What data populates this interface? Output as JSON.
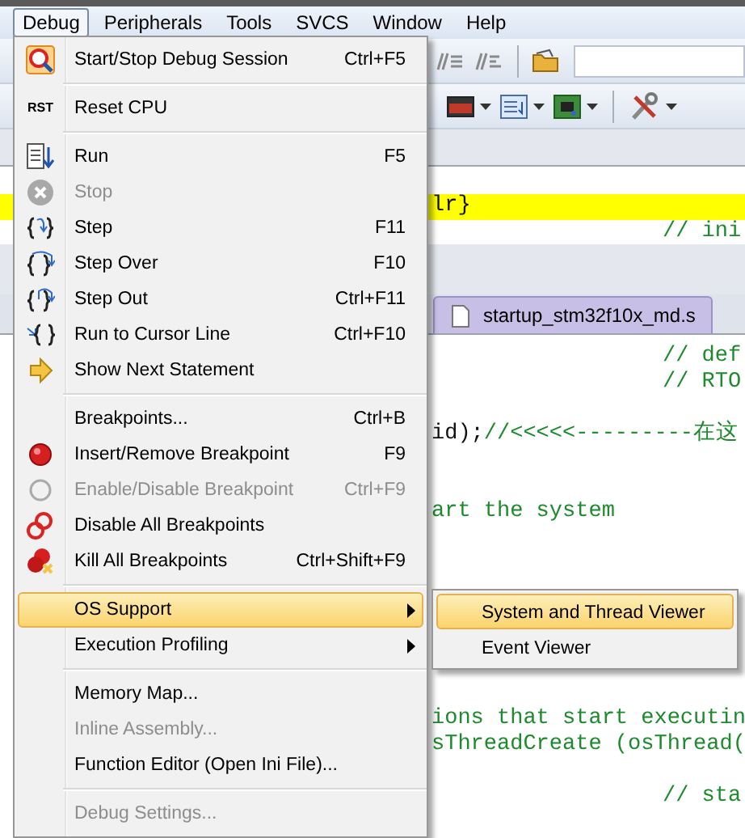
{
  "menubar": [
    {
      "label": "Debug",
      "selected": true
    },
    {
      "label": "Peripherals",
      "selected": false
    },
    {
      "label": "Tools",
      "selected": false
    },
    {
      "label": "SVCS",
      "selected": false
    },
    {
      "label": "Window",
      "selected": false
    },
    {
      "label": "Help",
      "selected": false
    }
  ],
  "editor_top": {
    "lines": [
      {
        "kind": "tail",
        "highlighted": true,
        "parts": [
          {
            "kind": "code",
            "text": "lr}"
          }
        ]
      },
      {
        "kind": "aside",
        "highlighted": false,
        "parts": [
          {
            "kind": "comment",
            "text": "// ini"
          }
        ]
      }
    ]
  },
  "tabs": [
    {
      "label": "startup_stm32f10x_md.s"
    }
  ],
  "editor_bottom": {
    "lines": [
      {
        "kind": "aside",
        "highlighted": false,
        "parts": [
          {
            "kind": "comment",
            "text": "// def"
          }
        ]
      },
      {
        "kind": "aside",
        "highlighted": false,
        "parts": [
          {
            "kind": "comment",
            "text": "// RTO"
          }
        ]
      },
      {
        "kind": "tail",
        "highlighted": false,
        "parts": [
          {
            "kind": "code",
            "text": "id);"
          },
          {
            "kind": "comment",
            "text": "//<<<<<---------在这"
          }
        ]
      },
      {
        "kind": "tail",
        "highlighted": false,
        "parts": [
          {
            "kind": "comment",
            "text": "art the system"
          }
        ]
      },
      {
        "kind": "tail",
        "highlighted": false,
        "parts": [
          {
            "kind": "comment",
            "text": "ions that start executin"
          }
        ]
      },
      {
        "kind": "tail",
        "highlighted": false,
        "parts": [
          {
            "kind": "comment",
            "text": "sThreadCreate (osThread("
          }
        ]
      },
      {
        "kind": "aside",
        "highlighted": false,
        "parts": [
          {
            "kind": "comment",
            "text": "// sta"
          }
        ]
      }
    ]
  },
  "menu": {
    "groups": [
      [
        {
          "label": "Start/Stop Debug Session",
          "shortcut": "Ctrl+F5",
          "disabled": false,
          "selected": false,
          "submenu": false
        }
      ],
      [
        {
          "label": "Reset CPU",
          "icon_text": "RST",
          "disabled": false,
          "selected": false,
          "submenu": false
        }
      ],
      [
        {
          "label": "Run",
          "shortcut": "F5",
          "disabled": false,
          "selected": false,
          "submenu": false
        },
        {
          "label": "Stop",
          "disabled": true,
          "selected": false,
          "submenu": false
        },
        {
          "label": "Step",
          "shortcut": "F11",
          "disabled": false,
          "selected": false,
          "submenu": false
        },
        {
          "label": "Step Over",
          "shortcut": "F10",
          "disabled": false,
          "selected": false,
          "submenu": false
        },
        {
          "label": "Step Out",
          "shortcut": "Ctrl+F11",
          "disabled": false,
          "selected": false,
          "submenu": false
        },
        {
          "label": "Run to Cursor Line",
          "shortcut": "Ctrl+F10",
          "disabled": false,
          "selected": false,
          "submenu": false
        },
        {
          "label": "Show Next Statement",
          "disabled": false,
          "selected": false,
          "submenu": false
        }
      ],
      [
        {
          "label": "Breakpoints...",
          "shortcut": "Ctrl+B",
          "disabled": false,
          "selected": false,
          "submenu": false
        },
        {
          "label": "Insert/Remove Breakpoint",
          "shortcut": "F9",
          "disabled": false,
          "selected": false,
          "submenu": false
        },
        {
          "label": "Enable/Disable Breakpoint",
          "shortcut": "Ctrl+F9",
          "disabled": true,
          "selected": false,
          "submenu": false
        },
        {
          "label": "Disable All Breakpoints",
          "disabled": false,
          "selected": false,
          "submenu": false
        },
        {
          "label": "Kill All Breakpoints",
          "shortcut": "Ctrl+Shift+F9",
          "disabled": false,
          "selected": false,
          "submenu": false
        }
      ],
      [
        {
          "label": "OS Support",
          "disabled": false,
          "selected": true,
          "submenu": true
        },
        {
          "label": "Execution Profiling",
          "disabled": false,
          "selected": false,
          "submenu": true
        }
      ],
      [
        {
          "label": "Memory Map...",
          "disabled": false,
          "selected": false,
          "submenu": false
        },
        {
          "label": "Inline Assembly...",
          "disabled": true,
          "selected": false,
          "submenu": false
        },
        {
          "label": "Function Editor (Open Ini File)...",
          "disabled": false,
          "selected": false,
          "submenu": false
        }
      ],
      [
        {
          "label": "Debug Settings...",
          "disabled": true,
          "selected": false,
          "submenu": false
        }
      ]
    ]
  },
  "submenu": {
    "items": [
      {
        "label": "System and Thread Viewer",
        "selected": true
      },
      {
        "label": "Event Viewer",
        "selected": false
      }
    ]
  }
}
